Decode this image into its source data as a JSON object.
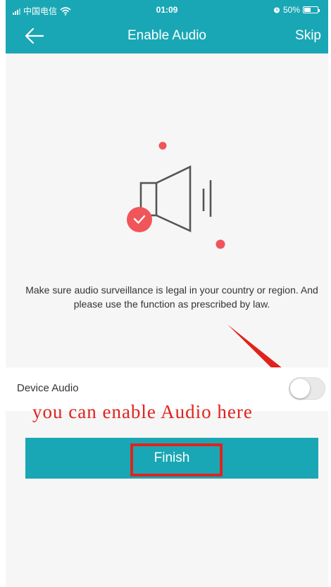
{
  "status_bar": {
    "carrier": "中国电信",
    "time": "01:09",
    "battery": "50%",
    "battery_level": 0.5
  },
  "header": {
    "title": "Enable Audio",
    "skip_label": "Skip"
  },
  "notice": "Make sure audio surveillance is legal in your country or region. And please use the function as prescribed by law.",
  "device_audio": {
    "label": "Device Audio",
    "enabled": false
  },
  "annotation": {
    "text": "you can enable Audio here"
  },
  "finish_label": "Finish",
  "colors": {
    "brand": "#1aa7b5",
    "annotation_red": "#e0231c",
    "check_badge": "#f0555a"
  }
}
